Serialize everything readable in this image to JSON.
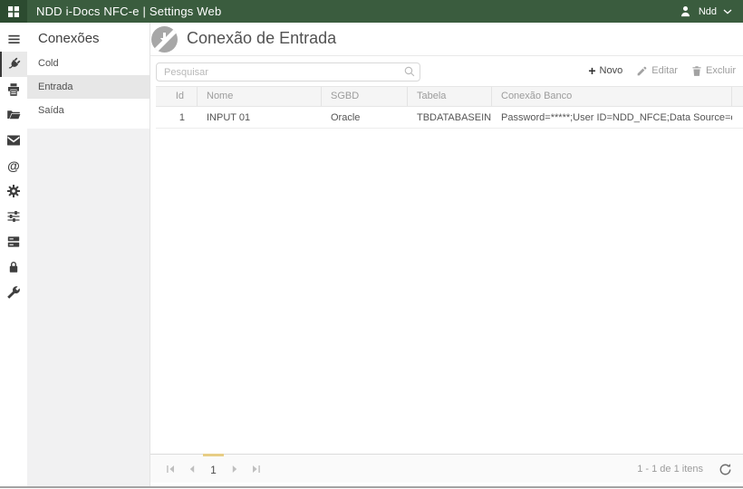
{
  "topbar": {
    "title": "NDD i-Docs NFC-e | Settings Web",
    "user_name": "Ndd"
  },
  "icon_sidebar": {
    "items": [
      {
        "icon": "menu-icon"
      },
      {
        "icon": "plug-connections-icon",
        "selected": true
      },
      {
        "icon": "printer-icon"
      },
      {
        "icon": "folder-open-icon"
      },
      {
        "icon": "envelope-icon"
      },
      {
        "icon": "at-sign-icon"
      },
      {
        "icon": "gear-icon"
      },
      {
        "icon": "sliders-icon"
      },
      {
        "icon": "server-icon"
      },
      {
        "icon": "lock-icon"
      },
      {
        "icon": "wrench-icon"
      }
    ]
  },
  "sidebar": {
    "title": "Conexões",
    "items": [
      {
        "label": "Cold",
        "selected": false
      },
      {
        "label": "Entrada",
        "selected": true
      },
      {
        "label": "Saída",
        "selected": false
      }
    ]
  },
  "main": {
    "title": "Conexão de Entrada",
    "search": {
      "placeholder": "Pesquisar",
      "value": ""
    },
    "toolbar": {
      "new_label": "Novo",
      "edit_label": "Editar",
      "delete_label": "Excluir"
    },
    "table": {
      "columns": [
        "Id",
        "Nome",
        "SGBD",
        "Tabela",
        "Conexão Banco"
      ],
      "rows": [
        [
          "1",
          "INPUT 01",
          "Oracle",
          "TBDATABASEINPUT",
          "Password=*****;User ID=NDD_NFCE;Data Source=orcl"
        ]
      ]
    },
    "pager": {
      "current_page": "1",
      "info": "1 - 1 de 1 itens"
    }
  },
  "colors": {
    "topbar_green": "#3A5C3E",
    "topbar_dark_green": "#2C4B30",
    "selected_item_gray": "#e7e7e7",
    "pager_accent_yellow": "#e7cd85"
  }
}
